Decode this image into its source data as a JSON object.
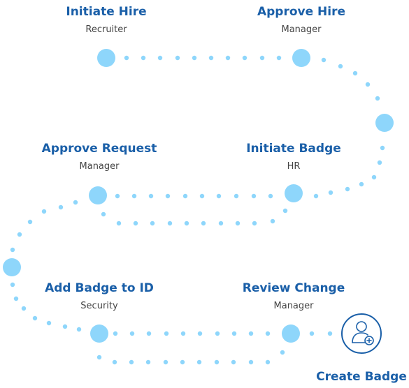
{
  "steps": [
    {
      "title": "Initiate Hire",
      "role": "Recruiter"
    },
    {
      "title": "Approve Hire",
      "role": "Manager"
    },
    {
      "title": "Approve Request",
      "role": "Manager"
    },
    {
      "title": "Initiate Badge",
      "role": "HR"
    },
    {
      "title": "Add Badge to ID",
      "role": "Security"
    },
    {
      "title": "Review Change",
      "role": "Manager"
    }
  ],
  "end": {
    "title": "Create Badge",
    "icon": "add-user-icon"
  },
  "colors": {
    "title": "#1a5fa8",
    "dot": "#8ed6fb",
    "node": "#8ed6fb",
    "icon": "#1a5fa8"
  }
}
